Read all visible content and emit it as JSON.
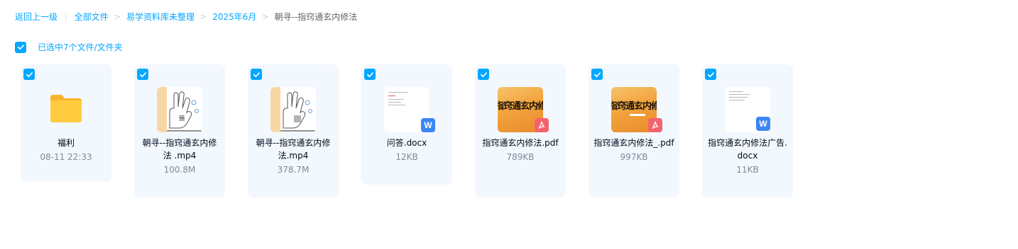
{
  "breadcrumb": {
    "back": "返回上一级",
    "items": [
      "全部文件",
      "易学资料库未整理",
      "2025年6月"
    ],
    "current": "朝寻--指窍通玄内修法"
  },
  "selection": {
    "label": "已选中7个文件/文件夹"
  },
  "files": [
    {
      "name": "福利",
      "meta": "08-11 22:33",
      "kind": "folder-icon"
    },
    {
      "name": "朝寻--指窍通玄内修法 .mp4",
      "meta": "100.8M",
      "kind": "video-thumbnail"
    },
    {
      "name": "朝寻--指窍通玄内修法.mp4",
      "meta": "378.7M",
      "kind": "video-thumbnail"
    },
    {
      "name": "问答.docx",
      "meta": "12KB",
      "kind": "word-icon"
    },
    {
      "name": "指窍通玄内修法.pdf",
      "meta": "789KB",
      "kind": "pdf-icon",
      "thumb_text": "指窍通玄内修法"
    },
    {
      "name": "指窍通玄内修法_.pdf",
      "meta": "997KB",
      "kind": "pdf-icon",
      "thumb_text": "指窍通玄内修法"
    },
    {
      "name": "指窍通玄内修法广告.docx",
      "meta": "11KB",
      "kind": "word-icon"
    }
  ],
  "colors": {
    "accent": "#06a7ff",
    "card_bg": "#f2f8fd",
    "meta_text": "#818999"
  }
}
